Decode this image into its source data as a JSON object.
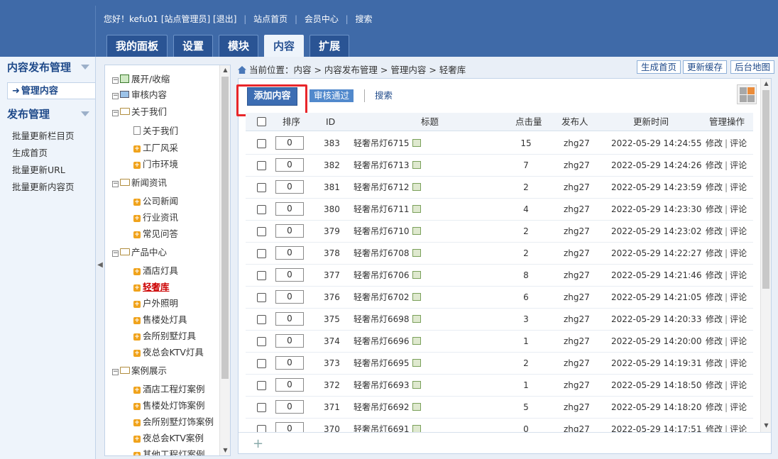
{
  "topbar": {
    "greeting": "您好！kefu01 [站点管理员]",
    "logout": "[退出]",
    "site_home": "站点首页",
    "member_center": "会员中心",
    "search": "搜索"
  },
  "tabs": [
    "我的面板",
    "设置",
    "模块",
    "内容",
    "扩展"
  ],
  "active_tab": "内容",
  "sidebar": {
    "section1": "内容发布管理",
    "active_item": "管理内容",
    "section2": "发布管理",
    "links": [
      "批量更新栏目页",
      "生成首页",
      "批量更新URL",
      "批量更新内容页"
    ]
  },
  "tree": {
    "toggle": "展开/收缩",
    "audit": "审核内容",
    "about": "关于我们",
    "about_children": [
      "关于我们",
      "工厂风采",
      "门市环境"
    ],
    "news": "新闻资讯",
    "news_children": [
      "公司新闻",
      "行业资讯",
      "常见问答"
    ],
    "products": "产品中心",
    "product_children": [
      "酒店灯具",
      "轻奢库",
      "户外照明",
      "售楼处灯具",
      "会所别墅灯具",
      "夜总会KTV灯具"
    ],
    "cases": "案例展示",
    "case_children": [
      "酒店工程灯案例",
      "售楼处灯饰案例",
      "会所别墅灯饰案例",
      "夜总会KTV案例",
      "其他工程灯案例"
    ]
  },
  "breadcrumb": "当前位置：内容 > 内容发布管理 > 管理内容 > 轻奢库",
  "quick_buttons": [
    "生成首页",
    "更新缓存",
    "后台地图"
  ],
  "toolbar": {
    "add": "添加内容",
    "audit_pass": "审核通过",
    "search": "搜索"
  },
  "columns": [
    "排序",
    "ID",
    "标题",
    "点击量",
    "发布人",
    "更新时间",
    "管理操作"
  ],
  "row_actions": {
    "edit": "修改",
    "comment": "评论"
  },
  "rows": [
    {
      "order": "0",
      "id": "383",
      "title": "轻奢吊灯6715",
      "hits": "15",
      "author": "zhg27",
      "time": "2022-05-29 14:24:55"
    },
    {
      "order": "0",
      "id": "382",
      "title": "轻奢吊灯6713",
      "hits": "7",
      "author": "zhg27",
      "time": "2022-05-29 14:24:26"
    },
    {
      "order": "0",
      "id": "381",
      "title": "轻奢吊灯6712",
      "hits": "2",
      "author": "zhg27",
      "time": "2022-05-29 14:23:59"
    },
    {
      "order": "0",
      "id": "380",
      "title": "轻奢吊灯6711",
      "hits": "4",
      "author": "zhg27",
      "time": "2022-05-29 14:23:30"
    },
    {
      "order": "0",
      "id": "379",
      "title": "轻奢吊灯6710",
      "hits": "2",
      "author": "zhg27",
      "time": "2022-05-29 14:23:02"
    },
    {
      "order": "0",
      "id": "378",
      "title": "轻奢吊灯6708",
      "hits": "2",
      "author": "zhg27",
      "time": "2022-05-29 14:22:27"
    },
    {
      "order": "0",
      "id": "377",
      "title": "轻奢吊灯6706",
      "hits": "8",
      "author": "zhg27",
      "time": "2022-05-29 14:21:46"
    },
    {
      "order": "0",
      "id": "376",
      "title": "轻奢吊灯6702",
      "hits": "6",
      "author": "zhg27",
      "time": "2022-05-29 14:21:05"
    },
    {
      "order": "0",
      "id": "375",
      "title": "轻奢吊灯6698",
      "hits": "3",
      "author": "zhg27",
      "time": "2022-05-29 14:20:33"
    },
    {
      "order": "0",
      "id": "374",
      "title": "轻奢吊灯6696",
      "hits": "1",
      "author": "zhg27",
      "time": "2022-05-29 14:20:00"
    },
    {
      "order": "0",
      "id": "373",
      "title": "轻奢吊灯6695",
      "hits": "2",
      "author": "zhg27",
      "time": "2022-05-29 14:19:31"
    },
    {
      "order": "0",
      "id": "372",
      "title": "轻奢吊灯6693",
      "hits": "1",
      "author": "zhg27",
      "time": "2022-05-29 14:18:50"
    },
    {
      "order": "0",
      "id": "371",
      "title": "轻奢吊灯6692",
      "hits": "5",
      "author": "zhg27",
      "time": "2022-05-29 14:18:20"
    },
    {
      "order": "0",
      "id": "370",
      "title": "轻奢吊灯6691",
      "hits": "0",
      "author": "zhg27",
      "time": "2022-05-29 14:17:51"
    }
  ],
  "colors": {
    "header": "#3f6aa8",
    "highlight": "#e8262a",
    "primary_button": "#3c6db3"
  }
}
